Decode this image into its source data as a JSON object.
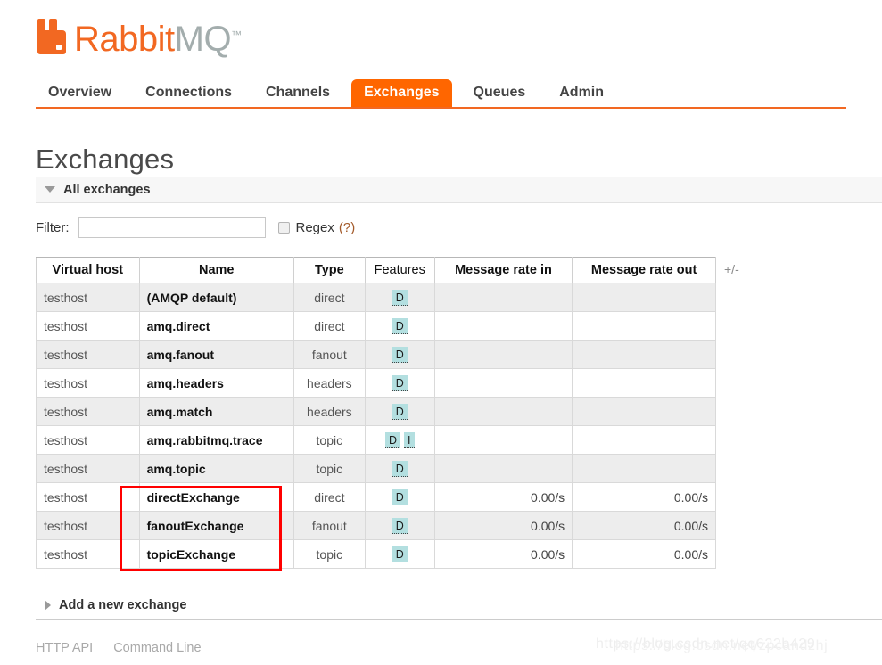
{
  "brand": {
    "name_part1": "Rabbit",
    "name_part2": "MQ",
    "trademark": "™"
  },
  "nav": {
    "items": [
      {
        "label": "Overview",
        "active": false
      },
      {
        "label": "Connections",
        "active": false
      },
      {
        "label": "Channels",
        "active": false
      },
      {
        "label": "Exchanges",
        "active": true
      },
      {
        "label": "Queues",
        "active": false
      },
      {
        "label": "Admin",
        "active": false
      }
    ],
    "accent_color": "#ff6600"
  },
  "page": {
    "title": "Exchanges"
  },
  "sections": {
    "all_exchanges_label": "All exchanges",
    "add_exchange_label": "Add a new exchange"
  },
  "filter": {
    "label": "Filter:",
    "value": "",
    "placeholder": "",
    "regex_label": "Regex",
    "regex_help": "(?)",
    "regex_checked": false
  },
  "table": {
    "columns": [
      "Virtual host",
      "Name",
      "Type",
      "Features",
      "Message rate in",
      "Message rate out"
    ],
    "column_toggle": "+/-",
    "rows": [
      {
        "vhost": "testhost",
        "name": "(AMQP default)",
        "type": "direct",
        "features": [
          "D"
        ],
        "rate_in": "",
        "rate_out": ""
      },
      {
        "vhost": "testhost",
        "name": "amq.direct",
        "type": "direct",
        "features": [
          "D"
        ],
        "rate_in": "",
        "rate_out": ""
      },
      {
        "vhost": "testhost",
        "name": "amq.fanout",
        "type": "fanout",
        "features": [
          "D"
        ],
        "rate_in": "",
        "rate_out": ""
      },
      {
        "vhost": "testhost",
        "name": "amq.headers",
        "type": "headers",
        "features": [
          "D"
        ],
        "rate_in": "",
        "rate_out": ""
      },
      {
        "vhost": "testhost",
        "name": "amq.match",
        "type": "headers",
        "features": [
          "D"
        ],
        "rate_in": "",
        "rate_out": ""
      },
      {
        "vhost": "testhost",
        "name": "amq.rabbitmq.trace",
        "type": "topic",
        "features": [
          "D",
          "I"
        ],
        "rate_in": "",
        "rate_out": ""
      },
      {
        "vhost": "testhost",
        "name": "amq.topic",
        "type": "topic",
        "features": [
          "D"
        ],
        "rate_in": "",
        "rate_out": ""
      },
      {
        "vhost": "testhost",
        "name": "directExchange",
        "type": "direct",
        "features": [
          "D"
        ],
        "rate_in": "0.00/s",
        "rate_out": "0.00/s"
      },
      {
        "vhost": "testhost",
        "name": "fanoutExchange",
        "type": "fanout",
        "features": [
          "D"
        ],
        "rate_in": "0.00/s",
        "rate_out": "0.00/s"
      },
      {
        "vhost": "testhost",
        "name": "topicExchange",
        "type": "topic",
        "features": [
          "D"
        ],
        "rate_in": "0.00/s",
        "rate_out": "0.00/s"
      }
    ]
  },
  "annotation": {
    "color": "#ff0000"
  },
  "footer": {
    "http_api": "HTTP API",
    "command_line": "Command Line"
  },
  "watermark": {
    "text": "https://blog.csdn.net/qq622b429",
    "text2": "https://blog.csdn.net/zpcandzhj"
  }
}
